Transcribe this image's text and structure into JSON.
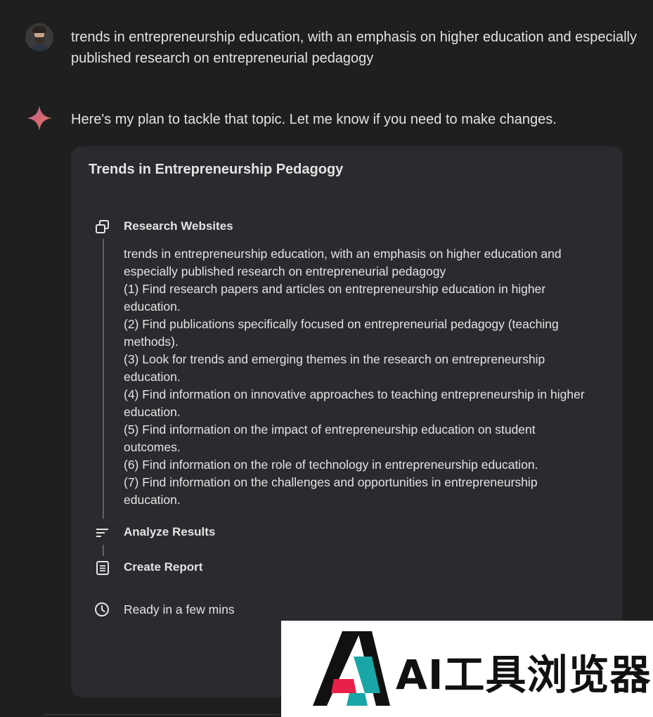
{
  "user_message": {
    "line1": "trends in entrepreneurship education, with an emphasis on higher education and especially",
    "line2": "published research on entrepreneurial pedagogy"
  },
  "assistant": {
    "intro": "Here's my plan to tackle that topic. Let me know if you need to make changes."
  },
  "plan": {
    "title": "Trends in Entrepreneurship Pedagogy",
    "steps": [
      {
        "label": "Research Websites",
        "icon": "open-in-new-window-icon",
        "body_lines": [
          "trends in entrepreneurship education, with an emphasis on higher education and",
          "especially published research on entrepreneurial pedagogy",
          "(1) Find research papers and articles on entrepreneurship education in higher",
          "education.",
          "(2) Find publications specifically focused on entrepreneurial pedagogy (teaching",
          "methods).",
          "(3) Look for trends and emerging themes in the research on entrepreneurship",
          "education.",
          "(4) Find information on innovative approaches to teaching entrepreneurship in higher",
          "education.",
          "(5) Find information on the impact of entrepreneurship education on student",
          "outcomes.",
          "(6) Find information on the role of technology in entrepreneurship education.",
          "(7) Find information on the challenges and opportunities in entrepreneurship",
          "education."
        ]
      },
      {
        "label": "Analyze Results",
        "icon": "sort-lines-icon"
      },
      {
        "label": "Create Report",
        "icon": "document-icon"
      }
    ],
    "ready": {
      "label": "Ready in a few mins",
      "icon": "clock-icon"
    }
  },
  "watermark": {
    "text": "AI工具浏览器",
    "colors": {
      "black": "#111111",
      "teal": "#1aa6a6",
      "red": "#e8204a"
    }
  },
  "colors": {
    "background": "#1f1f1f",
    "card": "#2a2b2e",
    "text": "#e3e3e3",
    "timeline": "#5f6368"
  }
}
